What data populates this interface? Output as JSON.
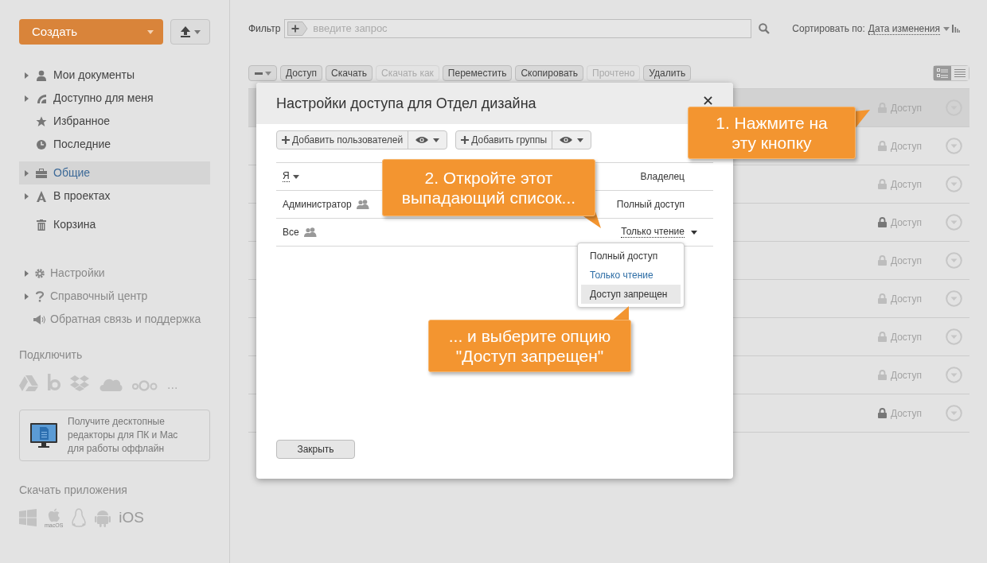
{
  "create_button": {
    "label": "Создать"
  },
  "sidebar": {
    "sections": [
      [
        {
          "label": "Мои документы",
          "expandable": true,
          "selected": false
        },
        {
          "label": "Доступно для меня",
          "expandable": true,
          "selected": false
        },
        {
          "label": "Избранное",
          "expandable": false,
          "selected": false
        },
        {
          "label": "Последние",
          "expandable": false,
          "selected": false
        }
      ],
      [
        {
          "label": "Общие",
          "expandable": true,
          "selected": true
        },
        {
          "label": "В проектах",
          "expandable": true,
          "selected": false
        }
      ],
      [
        {
          "label": "Корзина",
          "expandable": false,
          "selected": false
        }
      ]
    ],
    "settings_items": [
      {
        "label": "Настройки",
        "expandable": true
      },
      {
        "label": "Справочный центр",
        "expandable": true
      },
      {
        "label": "Обратная связь и поддержка",
        "expandable": false
      }
    ],
    "connect": {
      "title": "Подключить",
      "more": "..."
    },
    "promo": {
      "text": "Получите десктопные редакторы для ПК и Mac для работы оффлайн"
    },
    "apps": {
      "title": "Скачать приложения",
      "macos": "macOS",
      "ios": "iOS"
    }
  },
  "filter": {
    "label": "Фильтр",
    "placeholder": "введите запрос"
  },
  "sort": {
    "label": "Сортировать по:",
    "value": "Дата изменения"
  },
  "toolbar": {
    "buttons": [
      {
        "label": "Доступ",
        "disabled": false
      },
      {
        "label": "Скачать",
        "disabled": false
      },
      {
        "label": "Скачать как",
        "disabled": true
      },
      {
        "label": "Переместить",
        "disabled": false
      },
      {
        "label": "Скопировать",
        "disabled": false
      },
      {
        "label": "Прочтено",
        "disabled": true
      },
      {
        "label": "Удалить",
        "disabled": false
      }
    ]
  },
  "view_toggle": [
    {
      "selected": true
    },
    {
      "selected": false
    }
  ],
  "files": {
    "rows": [
      {
        "access": "Доступ",
        "shared": false,
        "selected": true
      },
      {
        "access": "Доступ",
        "shared": false,
        "selected": false
      },
      {
        "access": "Доступ",
        "shared": false,
        "selected": false
      },
      {
        "access": "Доступ",
        "shared": true,
        "selected": false
      },
      {
        "access": "Доступ",
        "shared": false,
        "selected": false
      },
      {
        "access": "Доступ",
        "shared": false,
        "selected": false
      },
      {
        "access": "Доступ",
        "shared": false,
        "selected": false
      },
      {
        "access": "Доступ",
        "shared": false,
        "selected": false
      },
      {
        "access": "Доступ",
        "shared": true,
        "selected": false
      }
    ]
  },
  "dialog": {
    "title": "Настройки доступа для Отдел дизайна",
    "add_buttons": [
      {
        "label": "Добавить пользователей"
      },
      {
        "label": "Добавить группы"
      }
    ],
    "rows": [
      {
        "name": "Я",
        "name_menu": true,
        "group": false,
        "access": "Владелец",
        "access_menu": false
      },
      {
        "name": "Администратор",
        "name_menu": false,
        "group": true,
        "access": "Полный доступ",
        "access_menu": false
      },
      {
        "name": "Все",
        "name_menu": false,
        "group": true,
        "access": "Только чтение",
        "access_menu": true
      }
    ],
    "access_options": [
      {
        "label": "Полный доступ",
        "selected": false,
        "highlighted": false
      },
      {
        "label": "Только чтение",
        "selected": true,
        "highlighted": false
      },
      {
        "label": "Доступ запрещен",
        "selected": false,
        "highlighted": true
      }
    ],
    "close_button": {
      "label": "Закрыть"
    }
  },
  "callouts": [
    {
      "text": "1. Нажмите на эту кнопку"
    },
    {
      "text": "2. Откройте этот выпадающий список..."
    },
    {
      "text": "... и выберите опцию \"Доступ запрещен\""
    }
  ]
}
